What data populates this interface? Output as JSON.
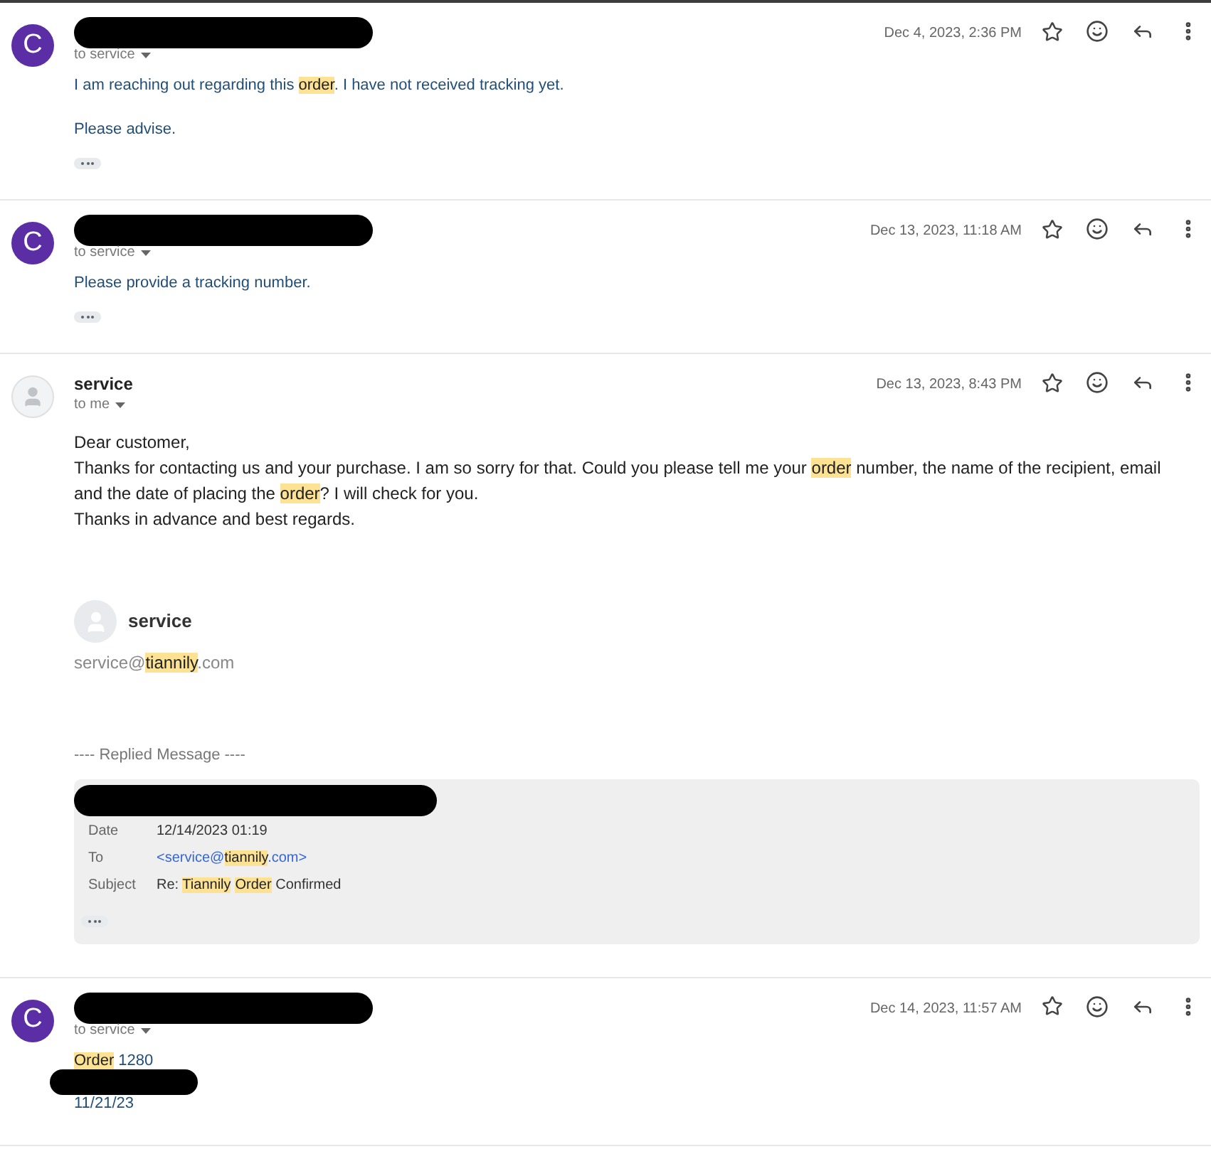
{
  "messages": [
    {
      "kind": "customer",
      "sender_redacted": true,
      "recipient": "to service",
      "date": "Dec 4, 2023, 2:36 PM",
      "avatar_letter": "C",
      "body": [
        {
          "kind": "text",
          "segments": [
            {
              "text": "I am reaching out regarding this ",
              "highlighted": false
            },
            {
              "text": "order",
              "highlighted": true
            },
            {
              "text": ". I have not received tracking yet.",
              "highlighted": false
            }
          ]
        },
        {
          "kind": "gap"
        },
        {
          "kind": "text",
          "segments": [
            {
              "text": "Please advise.",
              "highlighted": false
            }
          ]
        }
      ],
      "trimmed": true
    },
    {
      "kind": "customer",
      "sender_redacted": true,
      "recipient": "to service",
      "date": "Dec 13, 2023, 11:18 AM",
      "avatar_letter": "C",
      "body": [
        {
          "kind": "text",
          "segments": [
            {
              "text": "Please provide a tracking number.",
              "highlighted": false
            }
          ]
        }
      ],
      "trimmed": true
    },
    {
      "kind": "service",
      "sender_redacted": false,
      "sender": "service",
      "recipient": "to me",
      "date": "Dec 13, 2023, 8:43 PM",
      "body": [
        {
          "kind": "text",
          "segments": [
            {
              "text": "Dear customer,",
              "highlighted": false
            }
          ]
        },
        {
          "kind": "text",
          "segments": [
            {
              "text": "Thanks for contacting us and your purchase. I am so sorry for that. Could you please tell me your ",
              "highlighted": false
            },
            {
              "text": "order",
              "highlighted": true
            },
            {
              "text": " number, the name of the recipient, email and the date of placing the ",
              "highlighted": false
            },
            {
              "text": "order",
              "highlighted": true
            },
            {
              "text": "? I will check for you.",
              "highlighted": false
            }
          ]
        },
        {
          "kind": "text",
          "segments": [
            {
              "text": "Thanks in advance and best regards.",
              "highlighted": false
            }
          ]
        }
      ],
      "signature": {
        "name": "service",
        "email": [
          {
            "text": "service@",
            "highlighted": false
          },
          {
            "text": "tiannily",
            "highlighted": true
          },
          {
            "text": ".com",
            "highlighted": false
          }
        ]
      },
      "replied": {
        "heading": "---- Replied Message ----",
        "from_redacted": true,
        "rows": [
          {
            "label": "Date",
            "kind": "plain",
            "value": [
              {
                "text": "12/14/2023 01:19",
                "highlighted": false
              }
            ]
          },
          {
            "label": "To",
            "kind": "link",
            "value": [
              {
                "text": "<service@",
                "highlighted": false
              },
              {
                "text": "tiannily",
                "highlighted": true
              },
              {
                "text": ".com>",
                "highlighted": false
              }
            ]
          },
          {
            "label": "Subject",
            "kind": "plain",
            "value": [
              {
                "text": "Re: ",
                "highlighted": false
              },
              {
                "text": "Tiannily",
                "highlighted": true
              },
              {
                "text": "Order",
                "highlighted": true,
                "gap_before": true
              },
              {
                "text": " Confirmed",
                "highlighted": false
              }
            ]
          }
        ]
      },
      "trimmed": false
    },
    {
      "kind": "customer",
      "sender_redacted": true,
      "recipient": "to service",
      "date": "Dec 14, 2023, 11:57 AM",
      "avatar_letter": "C",
      "body": [
        {
          "kind": "text",
          "segments": [
            {
              "text": "Order",
              "highlighted": true
            },
            {
              "text": " 1280",
              "highlighted": false
            }
          ]
        },
        {
          "kind": "redacted"
        },
        {
          "kind": "text",
          "segments": [
            {
              "text": "11/21/23",
              "highlighted": false
            }
          ]
        }
      ],
      "trimmed": false
    }
  ]
}
